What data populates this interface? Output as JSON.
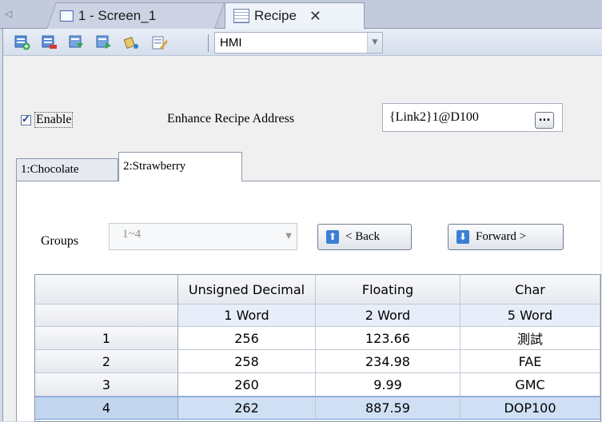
{
  "tabs": [
    {
      "label": "1 - Screen_1",
      "active": false
    },
    {
      "label": "Recipe",
      "active": true
    }
  ],
  "toolbar": {
    "buttons": [
      "add-row-icon",
      "delete-row-icon",
      "import-icon",
      "export-icon",
      "fill-icon",
      "edit-icon"
    ],
    "target_value": "HMI"
  },
  "enable": {
    "label": "Enable",
    "checked": true
  },
  "address": {
    "label": "Enhance Recipe Address",
    "value": "{Link2}1@D100",
    "browse": "..."
  },
  "recipe_tabs": [
    "1:Chocolate",
    "2:Strawberry"
  ],
  "groups": {
    "label": "Groups",
    "value": "1~4",
    "back": "< Back",
    "forward": "Forward >"
  },
  "table": {
    "columns": [
      "",
      "Unsigned Decimal",
      "Floating",
      "Char"
    ],
    "sizes": [
      "",
      "1 Word",
      "2 Word",
      "5 Word"
    ],
    "rows": [
      [
        "1",
        "256",
        "123.66",
        "測試"
      ],
      [
        "2",
        "258",
        "234.98",
        "FAE"
      ],
      [
        "3",
        "260",
        "9.99",
        "GMC"
      ],
      [
        "4",
        "262",
        "887.59",
        "DOP100"
      ]
    ],
    "selected_row": 4
  },
  "colors": {
    "tab_bg": "#c3cadb",
    "selection": "#cfe0f5",
    "accent": "#3a7fd4"
  }
}
